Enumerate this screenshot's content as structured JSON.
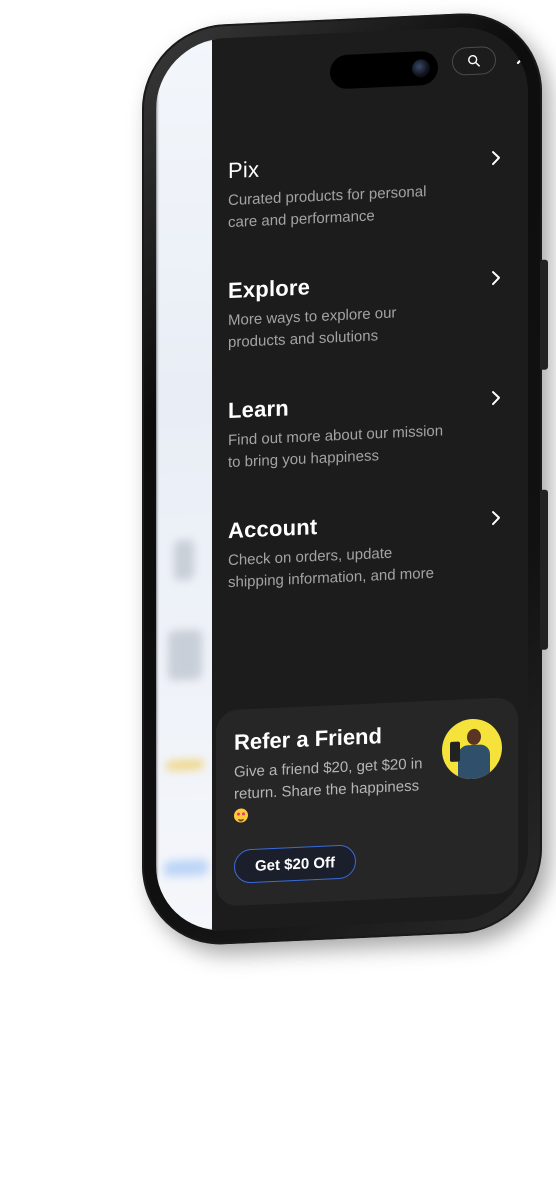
{
  "menu": {
    "items": [
      {
        "title": "Pix",
        "description": "Curated products for personal care and performance"
      },
      {
        "title": "Explore",
        "description": "More ways to explore our products and solutions"
      },
      {
        "title": "Learn",
        "description": "Find out more about our mission to bring you happiness"
      },
      {
        "title": "Account",
        "description": "Check on orders, update shipping information, and more"
      }
    ]
  },
  "icons": {
    "search": "search-icon",
    "close": "close-icon",
    "chevron": "chevron-right-icon"
  },
  "refer": {
    "title": "Refer a Friend",
    "description": "Give a friend $20, get $20 in return. Share the happiness",
    "button_label": "Get $20 Off"
  },
  "colors": {
    "panel": "#1c1c1c",
    "card": "#262626",
    "accent": "#3a6bd6",
    "avatar_bg": "#f5e23a"
  }
}
